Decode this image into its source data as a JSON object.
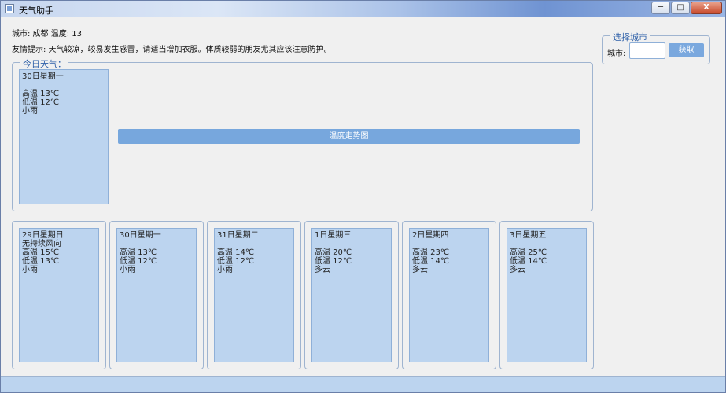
{
  "window": {
    "title": "天气助手",
    "buttons": {
      "minimize": "─",
      "maximize": "□",
      "close": "X"
    }
  },
  "info": {
    "city_line": "城市: 成都 温度: 13",
    "tip_line": "友情提示: 天气较凉，较易发生感冒，请适当增加衣服。体质较弱的朋友尤其应该注意防护。"
  },
  "today": {
    "legend": "今日天气：",
    "date": "30日星期一",
    "wind": "",
    "high": "高温 13℃",
    "low": "低温 12℃",
    "type": "小雨",
    "chart_button": "温度走势图"
  },
  "city_picker": {
    "legend": "选择城市",
    "label": "城市:",
    "input_value": "",
    "get_button": "获取"
  },
  "forecast": [
    {
      "date": "29日星期日",
      "wind": "无持续风向",
      "high": "高温 15℃",
      "low": "低温 13℃",
      "type": "小雨"
    },
    {
      "date": "30日星期一",
      "wind": "",
      "high": "高温 13℃",
      "low": "低温 12℃",
      "type": "小雨"
    },
    {
      "date": "31日星期二",
      "wind": "",
      "high": "高温 14℃",
      "low": "低温 12℃",
      "type": "小雨"
    },
    {
      "date": "1日星期三",
      "wind": "",
      "high": "高温 20℃",
      "low": "低温 12℃",
      "type": "多云"
    },
    {
      "date": "2日星期四",
      "wind": "",
      "high": "高温 23℃",
      "low": "低温 14℃",
      "type": "多云"
    },
    {
      "date": "3日星期五",
      "wind": "",
      "high": "高温 25℃",
      "low": "低温 14℃",
      "type": "多云"
    }
  ]
}
